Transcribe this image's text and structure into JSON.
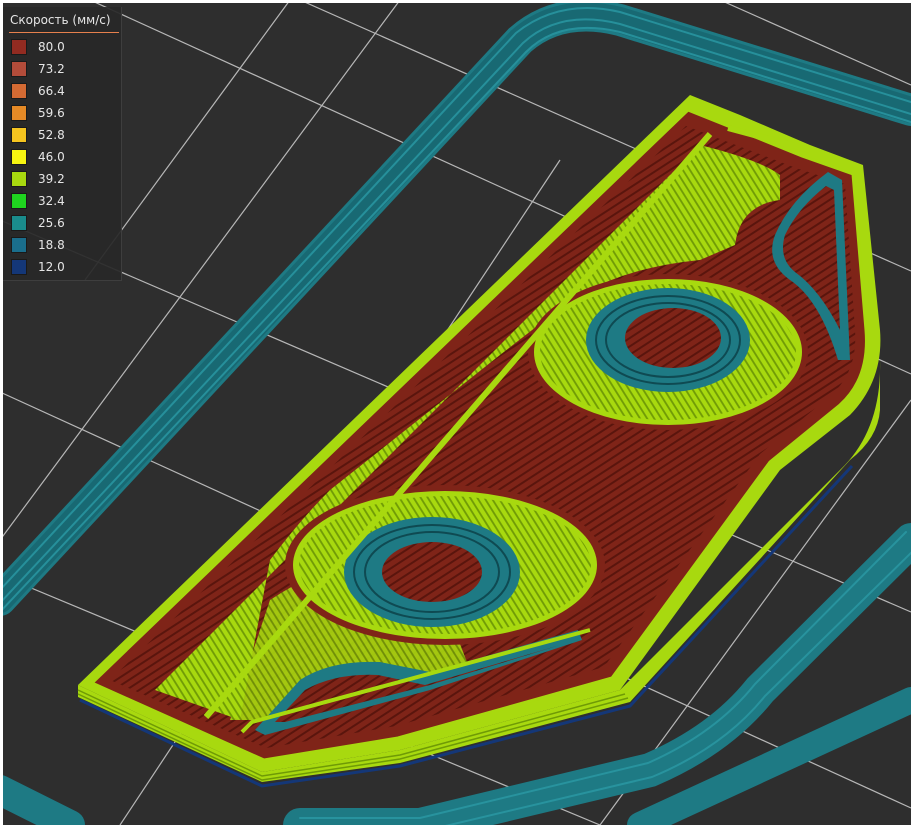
{
  "legend": {
    "title": "Скорость (мм/с)",
    "items": [
      {
        "value": "80.0",
        "color": "#922b21"
      },
      {
        "value": "73.2",
        "color": "#b34c3a"
      },
      {
        "value": "66.4",
        "color": "#d46a33"
      },
      {
        "value": "59.6",
        "color": "#e68a26"
      },
      {
        "value": "52.8",
        "color": "#f5c41f"
      },
      {
        "value": "46.0",
        "color": "#f7f511"
      },
      {
        "value": "39.2",
        "color": "#a8d90f"
      },
      {
        "value": "32.4",
        "color": "#1fd41f"
      },
      {
        "value": "25.6",
        "color": "#1a8c8c"
      },
      {
        "value": "18.8",
        "color": "#1a6e8c"
      },
      {
        "value": "12.0",
        "color": "#143778"
      }
    ]
  },
  "scene": {
    "background": "#2e2e2e",
    "grid_color": "#d0d0d0",
    "wall_color": "#a8d90f",
    "infill_color": "#7a1f14",
    "skirt_color": "#1e7a84",
    "base_color": "#143778"
  }
}
